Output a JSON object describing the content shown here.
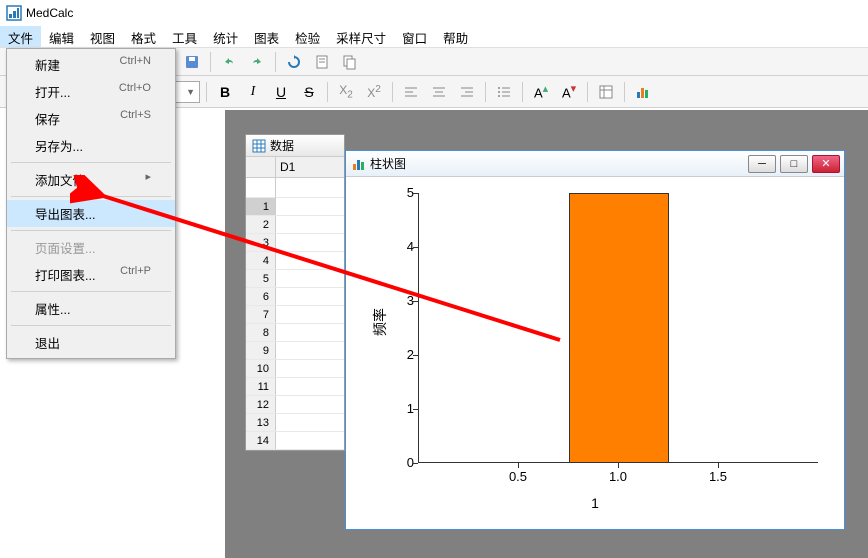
{
  "app_title": "MedCalc",
  "menus": [
    "文件",
    "编辑",
    "视图",
    "格式",
    "工具",
    "统计",
    "图表",
    "检验",
    "采样尺寸",
    "窗口",
    "帮助"
  ],
  "file_menu": {
    "new": {
      "label": "新建",
      "shortcut": "Ctrl+N"
    },
    "open": {
      "label": "打开...",
      "shortcut": "Ctrl+O"
    },
    "save": {
      "label": "保存",
      "shortcut": "Ctrl+S"
    },
    "saveas": {
      "label": "另存为..."
    },
    "addfile": {
      "label": "添加文件"
    },
    "export": {
      "label": "导出图表..."
    },
    "pagesetup": {
      "label": "页面设置..."
    },
    "printchart": {
      "label": "打印图表...",
      "shortcut": "Ctrl+P"
    },
    "props": {
      "label": "属性..."
    },
    "exit": {
      "label": "退出"
    }
  },
  "data_window": {
    "title": "数据",
    "col": "D1",
    "rows": [
      "1",
      "2",
      "3",
      "4",
      "5",
      "6",
      "7",
      "8",
      "9",
      "10",
      "11",
      "12",
      "13",
      "14"
    ]
  },
  "chart_window": {
    "title": "柱状图"
  },
  "chart_data": {
    "type": "bar",
    "categories": [
      1.0
    ],
    "values": [
      5
    ],
    "title": "",
    "xlabel": "1",
    "ylabel": "频率",
    "ylim": [
      0,
      5
    ],
    "yticks": [
      0,
      1,
      2,
      3,
      4,
      5
    ],
    "xticks": [
      0.5,
      1.0,
      1.5
    ]
  }
}
